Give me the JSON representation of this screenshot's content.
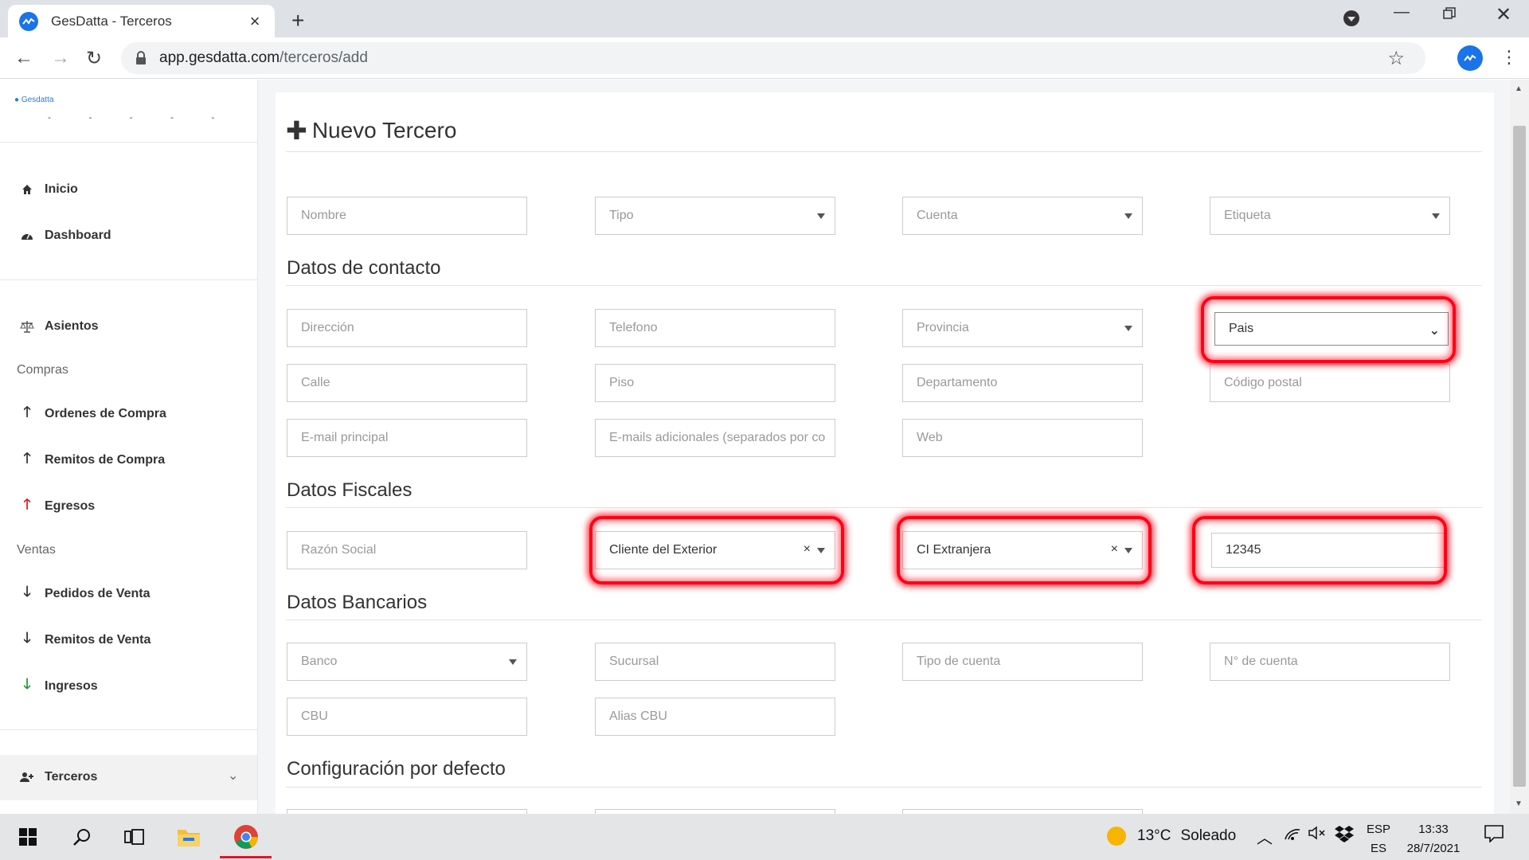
{
  "browser": {
    "tab_title": "GesDatta - Terceros",
    "new_tab": "+",
    "url_host": "app.gesdatta.com",
    "url_path": "/terceros/add"
  },
  "sidebar": {
    "logo_text": "Gesdatta",
    "items": [
      {
        "label": "Inicio",
        "icon": "home-icon"
      },
      {
        "label": "Dashboard",
        "icon": "dashboard-icon"
      },
      {
        "label": "Asientos",
        "icon": "balance-scale-icon"
      },
      {
        "label": "Ordenes de Compra",
        "icon": "arrow-up-icon"
      },
      {
        "label": "Remitos de Compra",
        "icon": "arrow-up-icon"
      },
      {
        "label": "Egresos",
        "icon": "arrow-up-red-icon"
      },
      {
        "label": "Pedidos de Venta",
        "icon": "arrow-down-icon"
      },
      {
        "label": "Remitos de Venta",
        "icon": "arrow-down-icon"
      },
      {
        "label": "Ingresos",
        "icon": "arrow-down-green-icon"
      },
      {
        "label": "Terceros",
        "icon": "user-plus-icon"
      }
    ],
    "sections": {
      "compras": "Compras",
      "ventas": "Ventas"
    }
  },
  "page": {
    "title": "Nuevo Tercero",
    "sections": {
      "contacto": "Datos de contacto",
      "fiscales": "Datos Fiscales",
      "bancarios": "Datos Bancarios",
      "configuracion": "Configuración por defecto"
    }
  },
  "form": {
    "nombre": "Nombre",
    "tipo": "Tipo",
    "cuenta": "Cuenta",
    "etiqueta": "Etiqueta",
    "direccion": "Dirección",
    "telefono": "Telefono",
    "provincia": "Provincia",
    "pais": "Pais",
    "calle": "Calle",
    "piso": "Piso",
    "departamento": "Departamento",
    "codigo_postal": "Código postal",
    "email": "E-mail principal",
    "emails_adicionales": "E-mails adicionales (separados por co",
    "web": "Web",
    "razon_social": "Razón Social",
    "condicion_value": "Cliente del Exterior",
    "documento_tipo_value": "CI Extranjera",
    "documento_numero_value": "12345",
    "banco": "Banco",
    "sucursal": "Sucursal",
    "tipo_cuenta": "Tipo de cuenta",
    "numero_cuenta": "N° de cuenta",
    "cbu": "CBU",
    "alias_cbu": "Alias CBU",
    "clear_symbol": "×"
  },
  "taskbar": {
    "temperature": "13°C",
    "weather": "Soleado",
    "lang_top": "ESP",
    "lang_bottom": "ES",
    "time": "13:33",
    "date": "28/7/2021"
  },
  "colors": {
    "highlight": "#ff0015",
    "brand": "#1a73e8"
  }
}
